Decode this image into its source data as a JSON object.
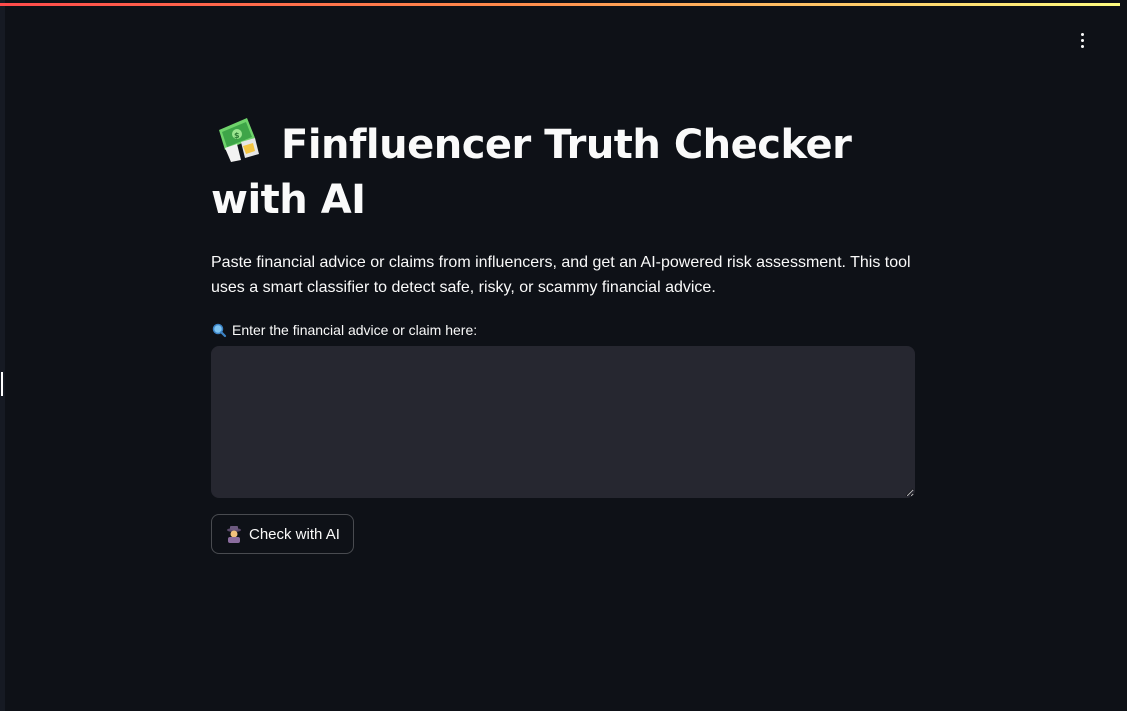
{
  "header": {
    "menu_icon": "kebab-menu-icon",
    "stripe_colors": [
      "#ff4b4b",
      "#fffd80"
    ]
  },
  "main": {
    "title_icon": "money-with-wings-icon",
    "title": "Finfluencer Truth Checker with AI",
    "description": "Paste financial advice or claims from influencers, and get an AI-powered risk assessment. This tool uses a smart classifier to detect safe, risky, or scammy financial advice.",
    "input": {
      "label_icon": "magnifying-glass-icon",
      "label": "Enter the financial advice or claim here:",
      "value": "",
      "placeholder": ""
    },
    "button": {
      "icon": "detective-icon",
      "label": "Check with AI"
    }
  },
  "theme": {
    "background": "#0e1117",
    "input_background": "#262730",
    "text": "#fafafa"
  }
}
